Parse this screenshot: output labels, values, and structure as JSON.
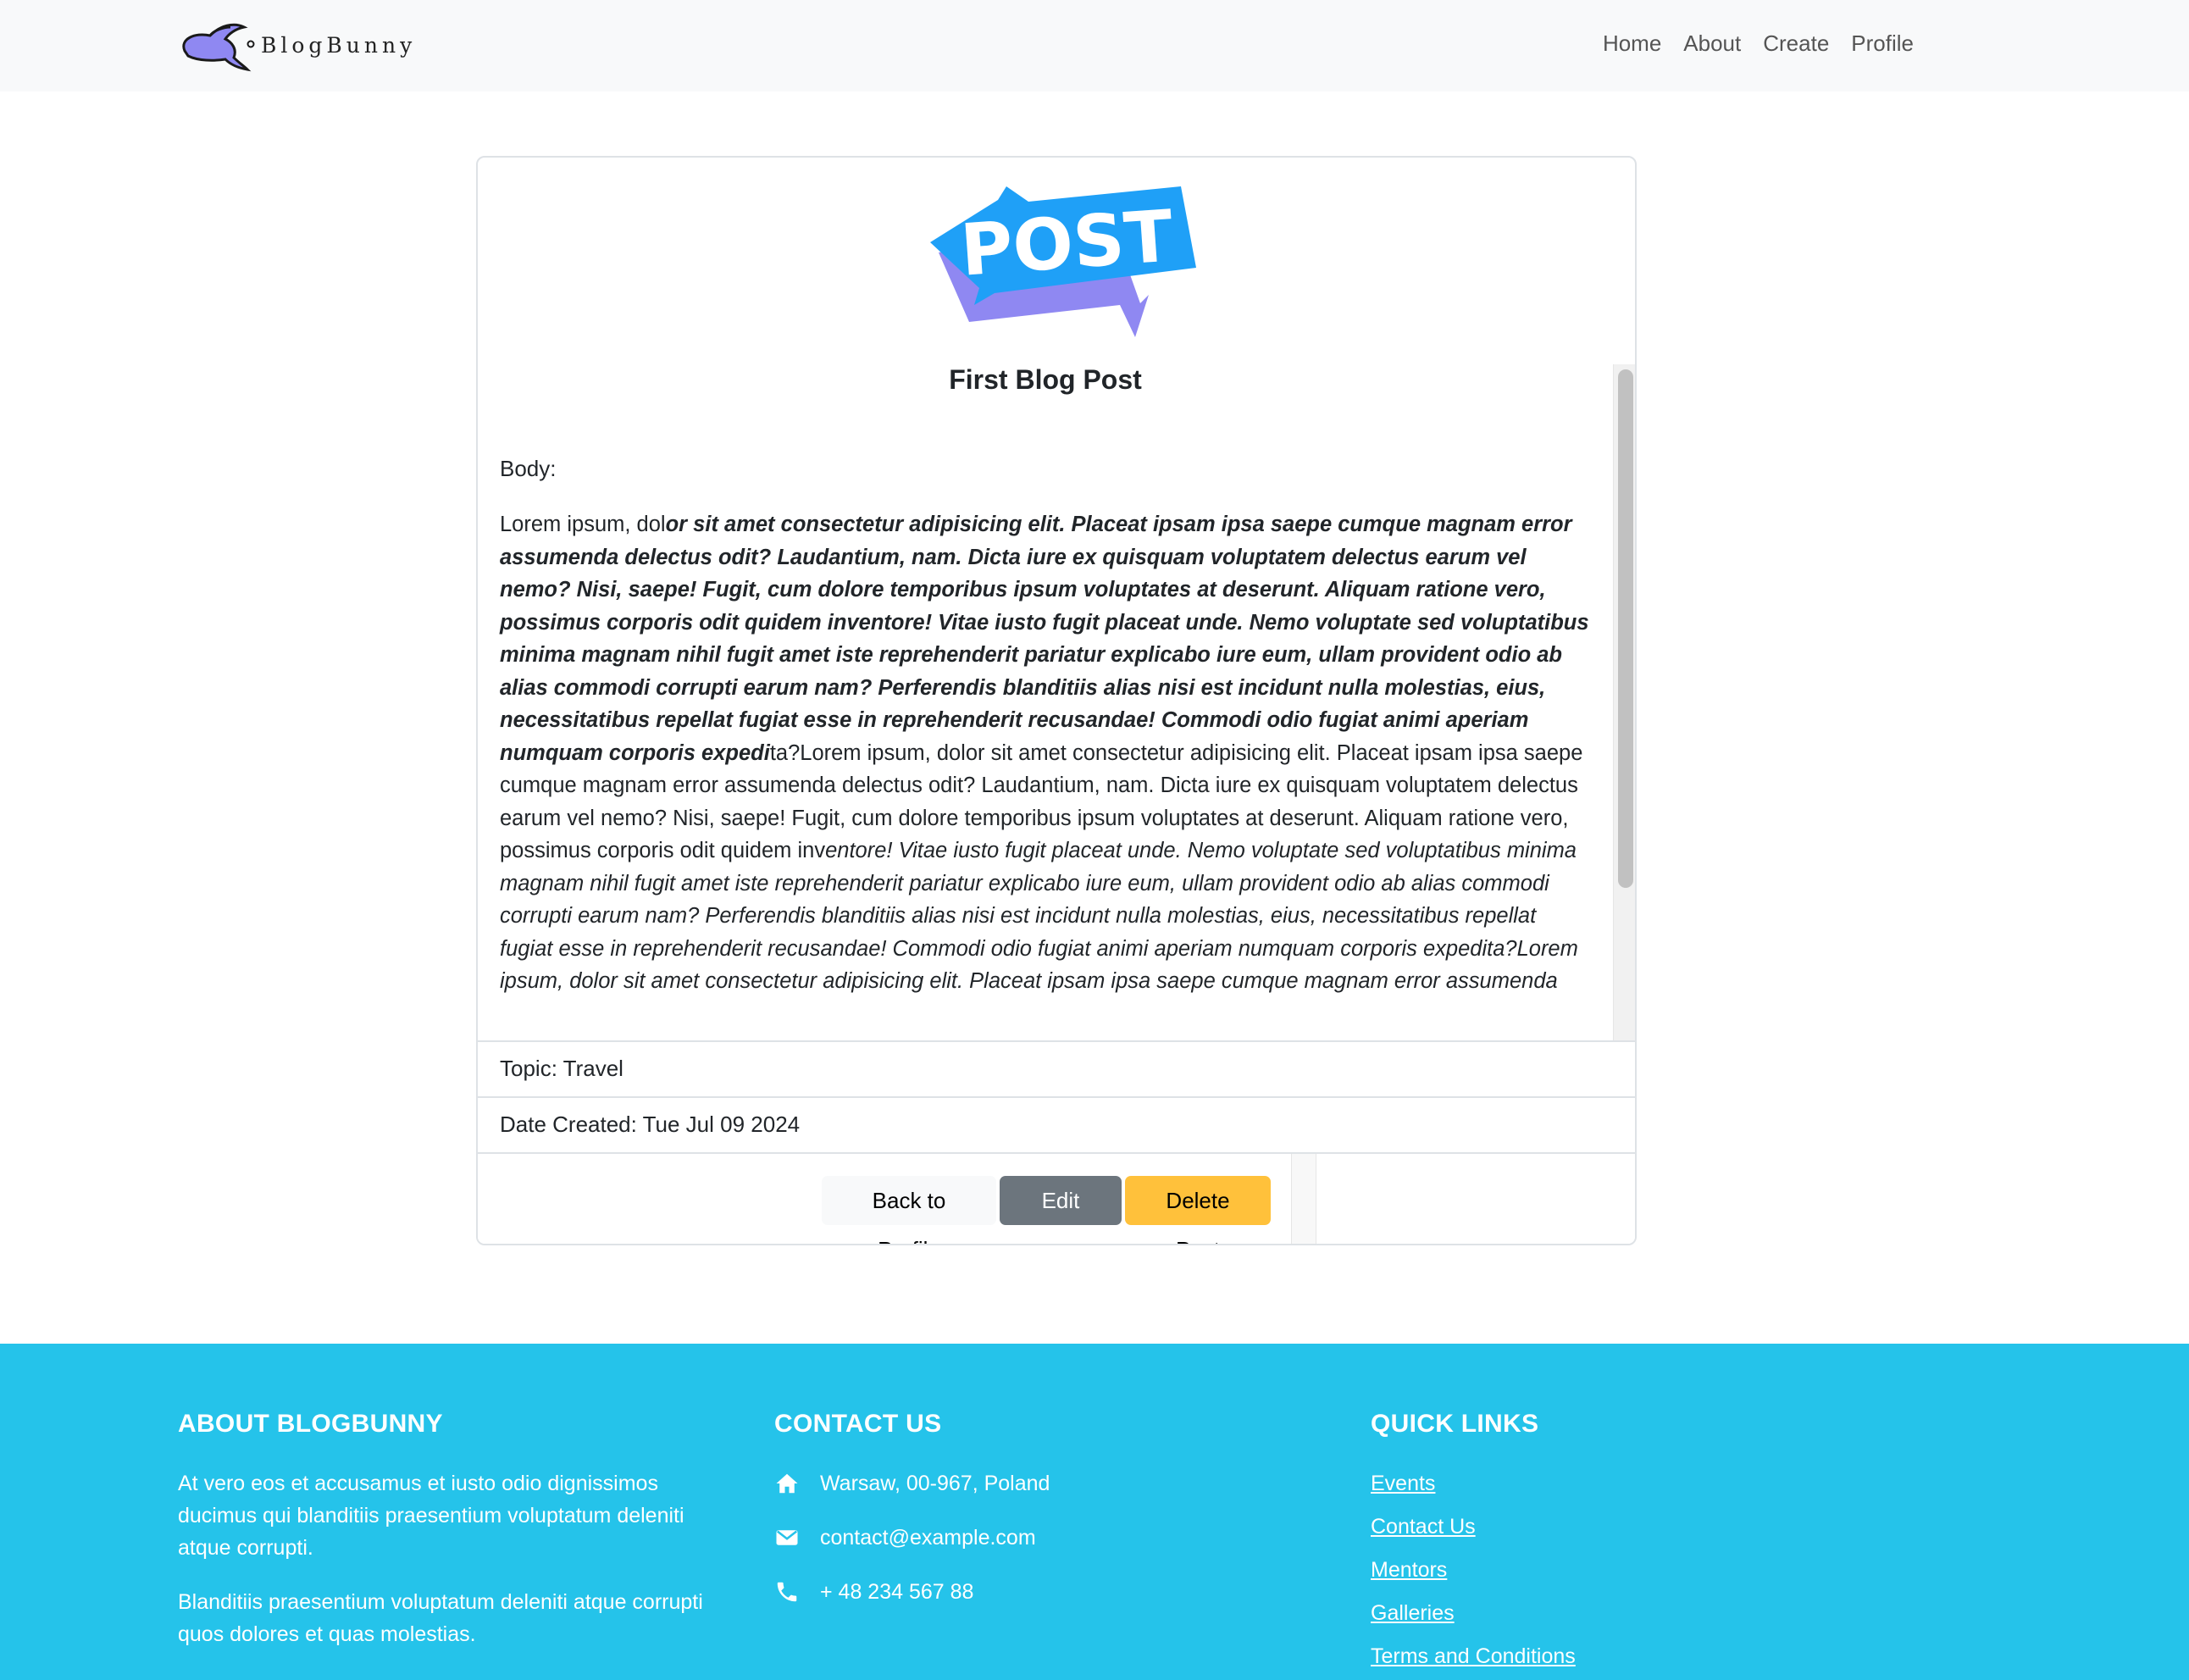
{
  "brand": {
    "name": "BlogBunny"
  },
  "nav": {
    "items": [
      "Home",
      "About",
      "Create",
      "Profile"
    ]
  },
  "post": {
    "image_text": "POST",
    "title": "First Blog Post",
    "body_label": "Body:",
    "body_segments": [
      {
        "style": "normal",
        "text": "Lorem ipsum, dol"
      },
      {
        "style": "bold-italic",
        "text": "or sit amet consectetur adipisicing elit. Placeat ipsam ipsa saepe cumque magnam error assumenda delectus odit? Laudantium, nam. Dicta iure ex quisquam voluptatem delectus earum vel nemo? Nisi, saepe! Fugit, cum dolore temporibus ipsum voluptates at deserunt. Aliquam ratione vero, possimus corporis odit quidem inventore! Vitae iusto fugit placeat unde. Nemo voluptate sed voluptatibus minima magnam nihil fugit amet iste reprehenderit pariatur explicabo iure eum, ullam provident odio ab alias commodi corrupti earum nam? Perferendis blanditiis alias nisi est incidunt nulla molestias, eius, necessitatibus repellat fugiat esse in reprehenderit recusandae! Commodi odio fugiat animi aperiam numquam corporis expedi"
      },
      {
        "style": "normal",
        "text": "ta?Lorem ipsum, dolor sit amet consectetur adipisicing elit. Placeat ipsam ipsa saepe cumque magnam error assumenda delectus odit? Laudantium, nam. Dicta iure ex quisquam voluptatem delectus earum vel nemo? Nisi, saepe! Fugit, cum dolore temporibus ipsum voluptates at deserunt. Aliquam ratione vero, possimus corporis odit quidem inv"
      },
      {
        "style": "italic",
        "text": "entore! Vitae iusto fugit placeat unde. Nemo voluptate sed voluptatibus minima magnam nihil fugit amet iste reprehenderit pariatur explicabo iure eum, ullam provident odio ab alias commodi corrupti earum nam? Perferendis blanditiis alias nisi est incidunt nulla molestias, eius, necessitatibus repellat fugiat esse in reprehenderit recusandae! Commodi odio fugiat animi aperiam numquam corporis expedita?Lorem ipsum, dolor sit amet consectetur adipisicing elit. Placeat ipsam ipsa saepe cumque magnam error assumenda delectus odit? Laudantium, nam. Dicta iure ex quisquam voluptatem delectus earum vel nemo? Nisi, saepe! Fugit, cum dolore temporibus ipsum voluptates at deserunt. Aliquam ratione vero, possimus corporis odit quidem inventore! Vitae iusto fugit placeat unde. Nemo"
      }
    ],
    "topic": "Topic: Travel",
    "date_created": "Date Created: Tue Jul 09 2024",
    "buttons": {
      "back": "Back to Profile",
      "edit": "Edit Post",
      "delete": "Delete Post"
    }
  },
  "footer": {
    "about": {
      "heading": "ABOUT BLOGBUNNY",
      "p1": "At vero eos et accusamus et iusto odio dignissimos ducimus qui blanditiis praesentium voluptatum deleniti atque corrupti.",
      "p2": "Blanditiis praesentium voluptatum deleniti atque corrupti quos dolores et quas molestias."
    },
    "contact": {
      "heading": "CONTACT US",
      "address": "Warsaw, 00-967, Poland",
      "email": "contact@example.com",
      "phone": "+ 48 234 567 88"
    },
    "links": {
      "heading": "QUICK LINKS",
      "items": [
        "Events",
        "Contact Us",
        "Mentors",
        "Galleries",
        "Terms and Conditions"
      ]
    }
  },
  "colors": {
    "footer_bg": "#25c3ea",
    "edit_btn": "#6c757d",
    "delete_btn": "#ffc13b",
    "post_blue": "#1fa0f7",
    "post_purple": "#8f88f2"
  }
}
